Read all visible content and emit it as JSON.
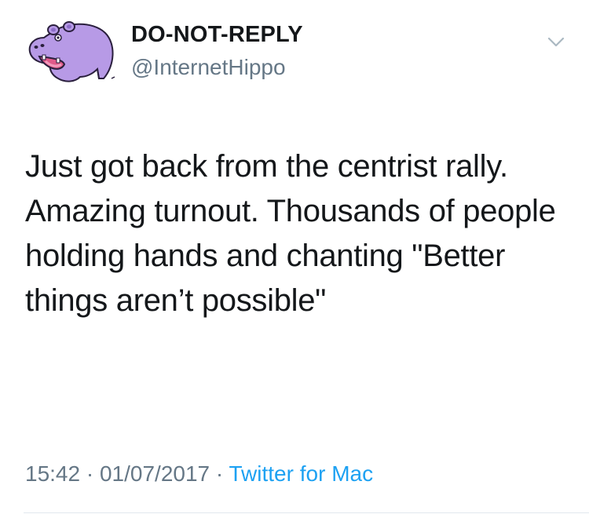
{
  "author": {
    "display_name": "DO-NOT-REPLY",
    "handle": "@InternetHippo",
    "avatar_icon": "purple-hippo-avatar"
  },
  "caret_icon": "chevron-down-icon",
  "tweet": {
    "text": "Just got back from the centrist rally. Amazing turnout. Thousands of people holding hands and chanting \"Better things aren’t possible\""
  },
  "meta": {
    "time": "15:42",
    "separator": "·",
    "date": "01/07/2017",
    "source": "Twitter for Mac"
  },
  "colors": {
    "text": "#14171a",
    "secondary": "#657786",
    "link": "#1da1f2",
    "avatar_purple": "#b79ae6"
  }
}
